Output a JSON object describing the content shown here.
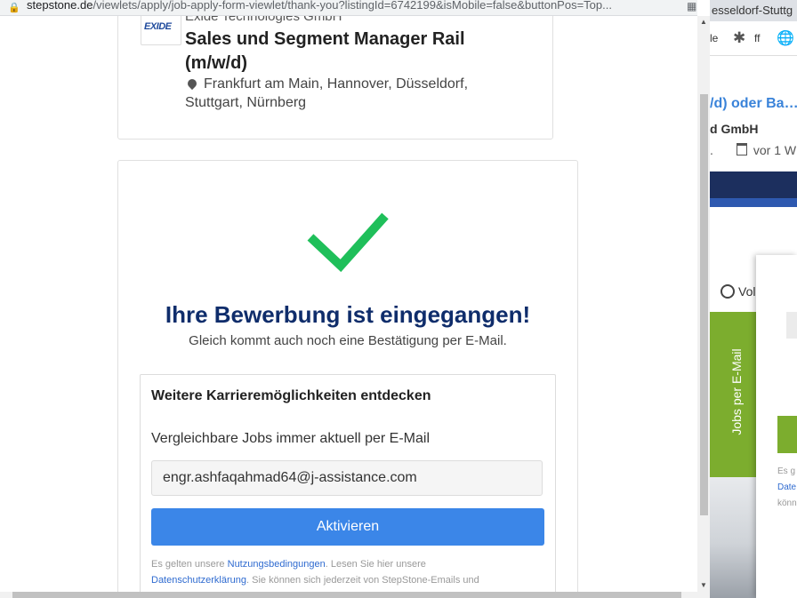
{
  "browser": {
    "url_host": "stepstone.de",
    "url_path": "/viewlets/apply/job-apply-form-viewlet/thank-you?listingId=6742199&isMobile=false&buttonPos=Top...",
    "lock_icon": "lock-icon",
    "extension_icon": "extension-icon"
  },
  "job": {
    "logo_text": "EXIDE",
    "company": "Exide Technologies GmbH",
    "title": "Sales und Segment Manager Rail (m/w/d)",
    "location": "Frankfurt am Main, Hannover, Düsseldorf, Stuttgart, Nürnberg"
  },
  "confirmation": {
    "headline": "Ihre Bewerbung ist eingegangen!",
    "subline": "Gleich kommt auch noch eine Bestätigung per E-Mail.",
    "check_color": "#1fbf5a"
  },
  "alert": {
    "heading": "Weitere Karrieremöglichkeiten entdecken",
    "label": "Vergleichbare Jobs immer aktuell per E-Mail",
    "email_value": "engr.ashfaqahmad64@j-assistance.com",
    "button_label": "Aktivieren",
    "terms_pre": "Es gelten unsere ",
    "terms_link1": "Nutzungsbedingungen",
    "terms_mid": ". Lesen Sie hier unsere ",
    "terms_link2": "Datenschutzerklärung",
    "terms_post": ". Sie können sich jederzeit von StepStone-Emails und",
    "button_color": "#3b86e8"
  },
  "background_page": {
    "tab_text": "esseldorf-Stuttg",
    "bar_item1": "le",
    "bar_item3": "ff",
    "job_title": "/d) oder Ba…",
    "company": "d GmbH",
    "date_prefix": ".",
    "date": "vor 1 W",
    "contract": "Vol",
    "sidebar_label": "Jobs per E-Mail",
    "panel_text1": "Es g",
    "panel_text2": "Date",
    "panel_text3": "könn"
  }
}
